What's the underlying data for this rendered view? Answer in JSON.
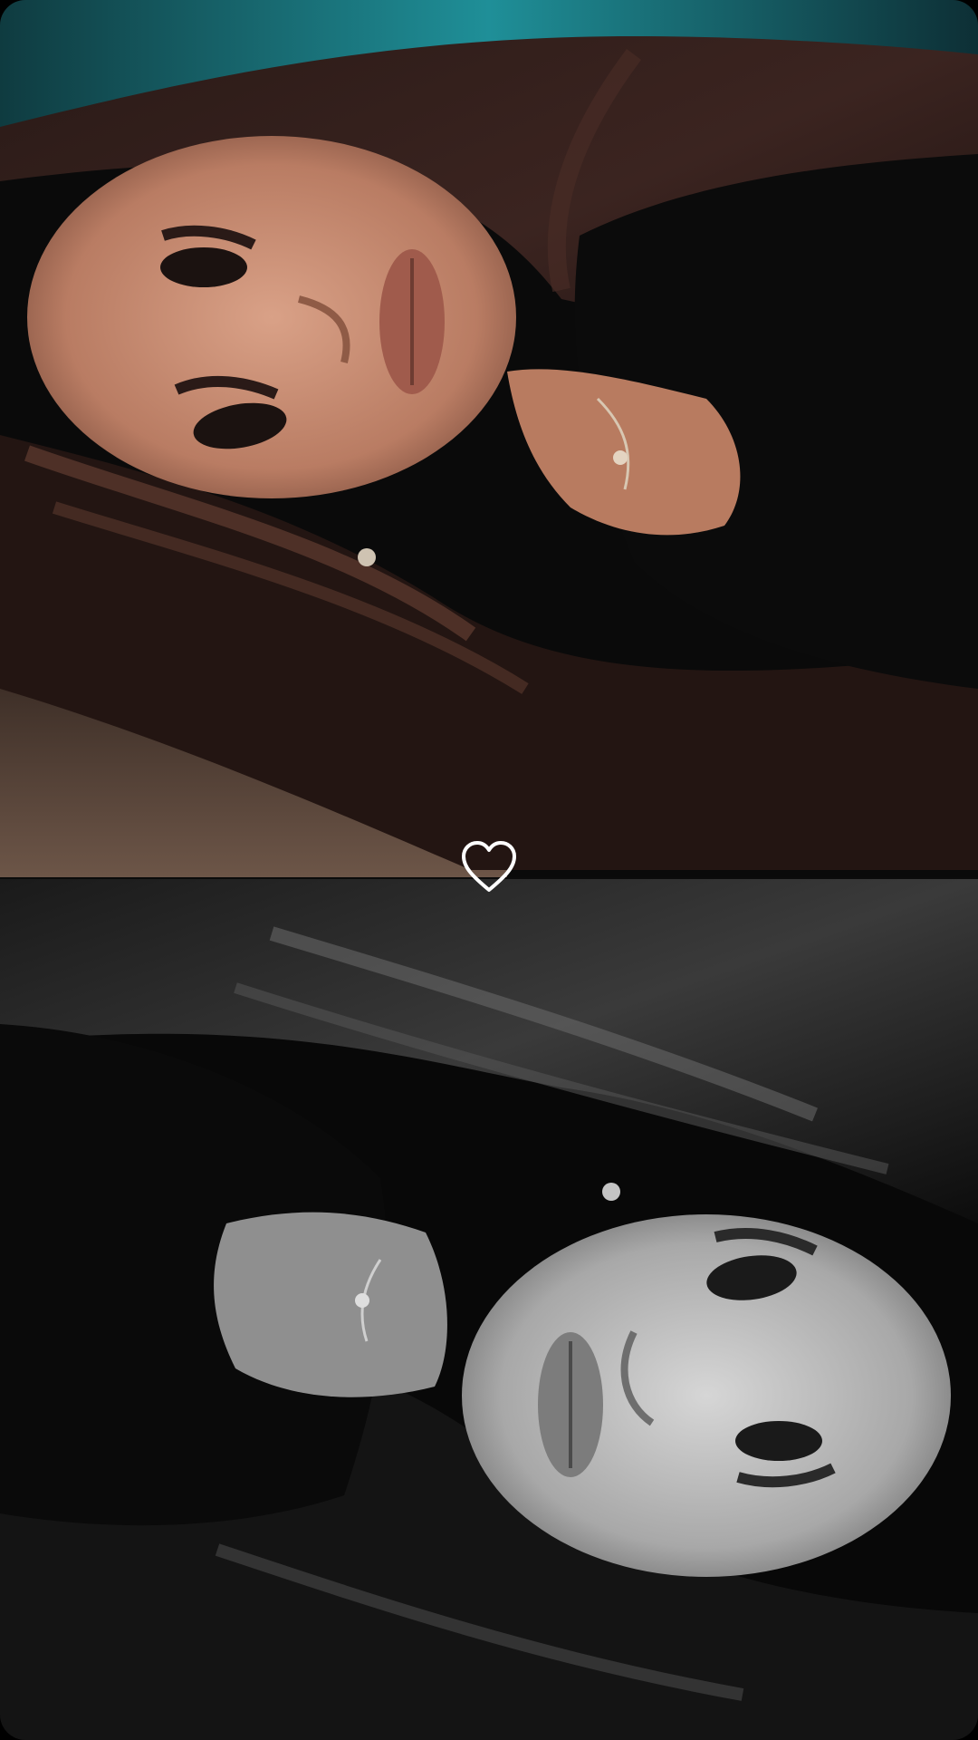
{
  "viewer": {
    "photos": [
      {
        "style": "color",
        "orientation": "rotated-left"
      },
      {
        "style": "monochrome",
        "orientation": "rotated-right"
      }
    ],
    "like_icon": "heart-outline-icon",
    "colors": {
      "background": "#050505",
      "accent_top": "#1f8f98",
      "icon": "#ffffff"
    }
  }
}
